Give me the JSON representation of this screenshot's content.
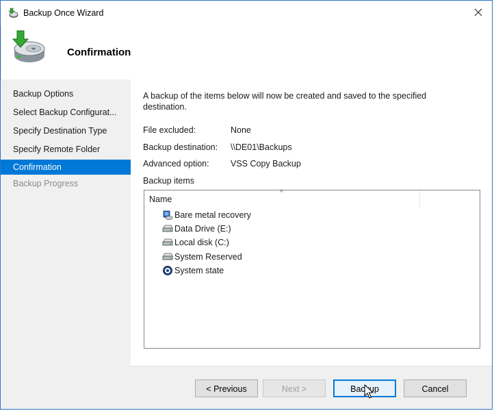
{
  "window": {
    "title": "Backup Once Wizard",
    "accent": "#0078d7"
  },
  "header": {
    "title": "Confirmation",
    "icon": "backup-disk-icon"
  },
  "sidebar": {
    "items": [
      {
        "label": "Backup Options",
        "state": "normal"
      },
      {
        "label": "Select Backup Configurat...",
        "state": "normal"
      },
      {
        "label": "Specify Destination Type",
        "state": "normal"
      },
      {
        "label": "Specify Remote Folder",
        "state": "normal"
      },
      {
        "label": "Confirmation",
        "state": "active"
      },
      {
        "label": "Backup Progress",
        "state": "disabled"
      }
    ]
  },
  "content": {
    "intro": "A backup of the items below will now be created and saved to the specified destination.",
    "details": [
      {
        "label": "File excluded:",
        "value": "None"
      },
      {
        "label": "Backup destination:",
        "value": "\\\\DE01\\Backups"
      },
      {
        "label": "Advanced option:",
        "value": "VSS Copy Backup"
      }
    ],
    "items_label": "Backup items",
    "list": {
      "column_name": "Name",
      "items": [
        {
          "name": "Bare metal recovery",
          "icon": "bare-metal-icon"
        },
        {
          "name": "Data Drive (E:)",
          "icon": "drive-icon"
        },
        {
          "name": "Local disk (C:)",
          "icon": "drive-icon"
        },
        {
          "name": "System Reserved",
          "icon": "drive-icon"
        },
        {
          "name": "System state",
          "icon": "system-state-icon"
        }
      ]
    }
  },
  "buttons": {
    "previous": "< Previous",
    "next": "Next >",
    "backup": "Backup",
    "cancel": "Cancel"
  }
}
